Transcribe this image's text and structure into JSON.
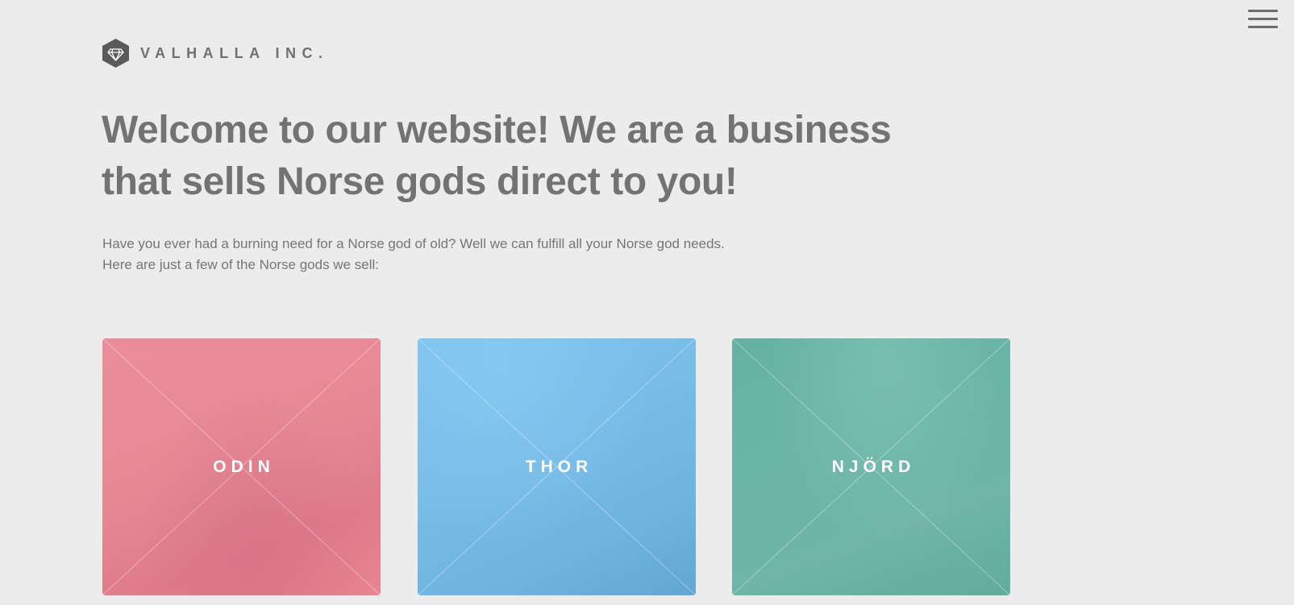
{
  "header": {
    "brand_name": "VALHALLA INC.",
    "logo_icon": "diamond-hexagon-icon",
    "menu_icon": "hamburger-menu-icon"
  },
  "hero": {
    "headline": "Welcome to our website! We are a business that sells Norse gods direct to you!",
    "intro_line_1": "Have you ever had a burning need for a Norse god of old? Well we can fulfill all your Norse god needs.",
    "intro_line_2": "Here are just a few of the Norse gods we sell:"
  },
  "gods": [
    {
      "name": "ODIN",
      "color": "#e78895"
    },
    {
      "name": "THOR",
      "color": "#77bbe7"
    },
    {
      "name": "NJÖRD",
      "color": "#6bb4a8"
    }
  ],
  "colors": {
    "background": "#ececec",
    "text": "#777777",
    "logo": "#5a5a5a"
  }
}
